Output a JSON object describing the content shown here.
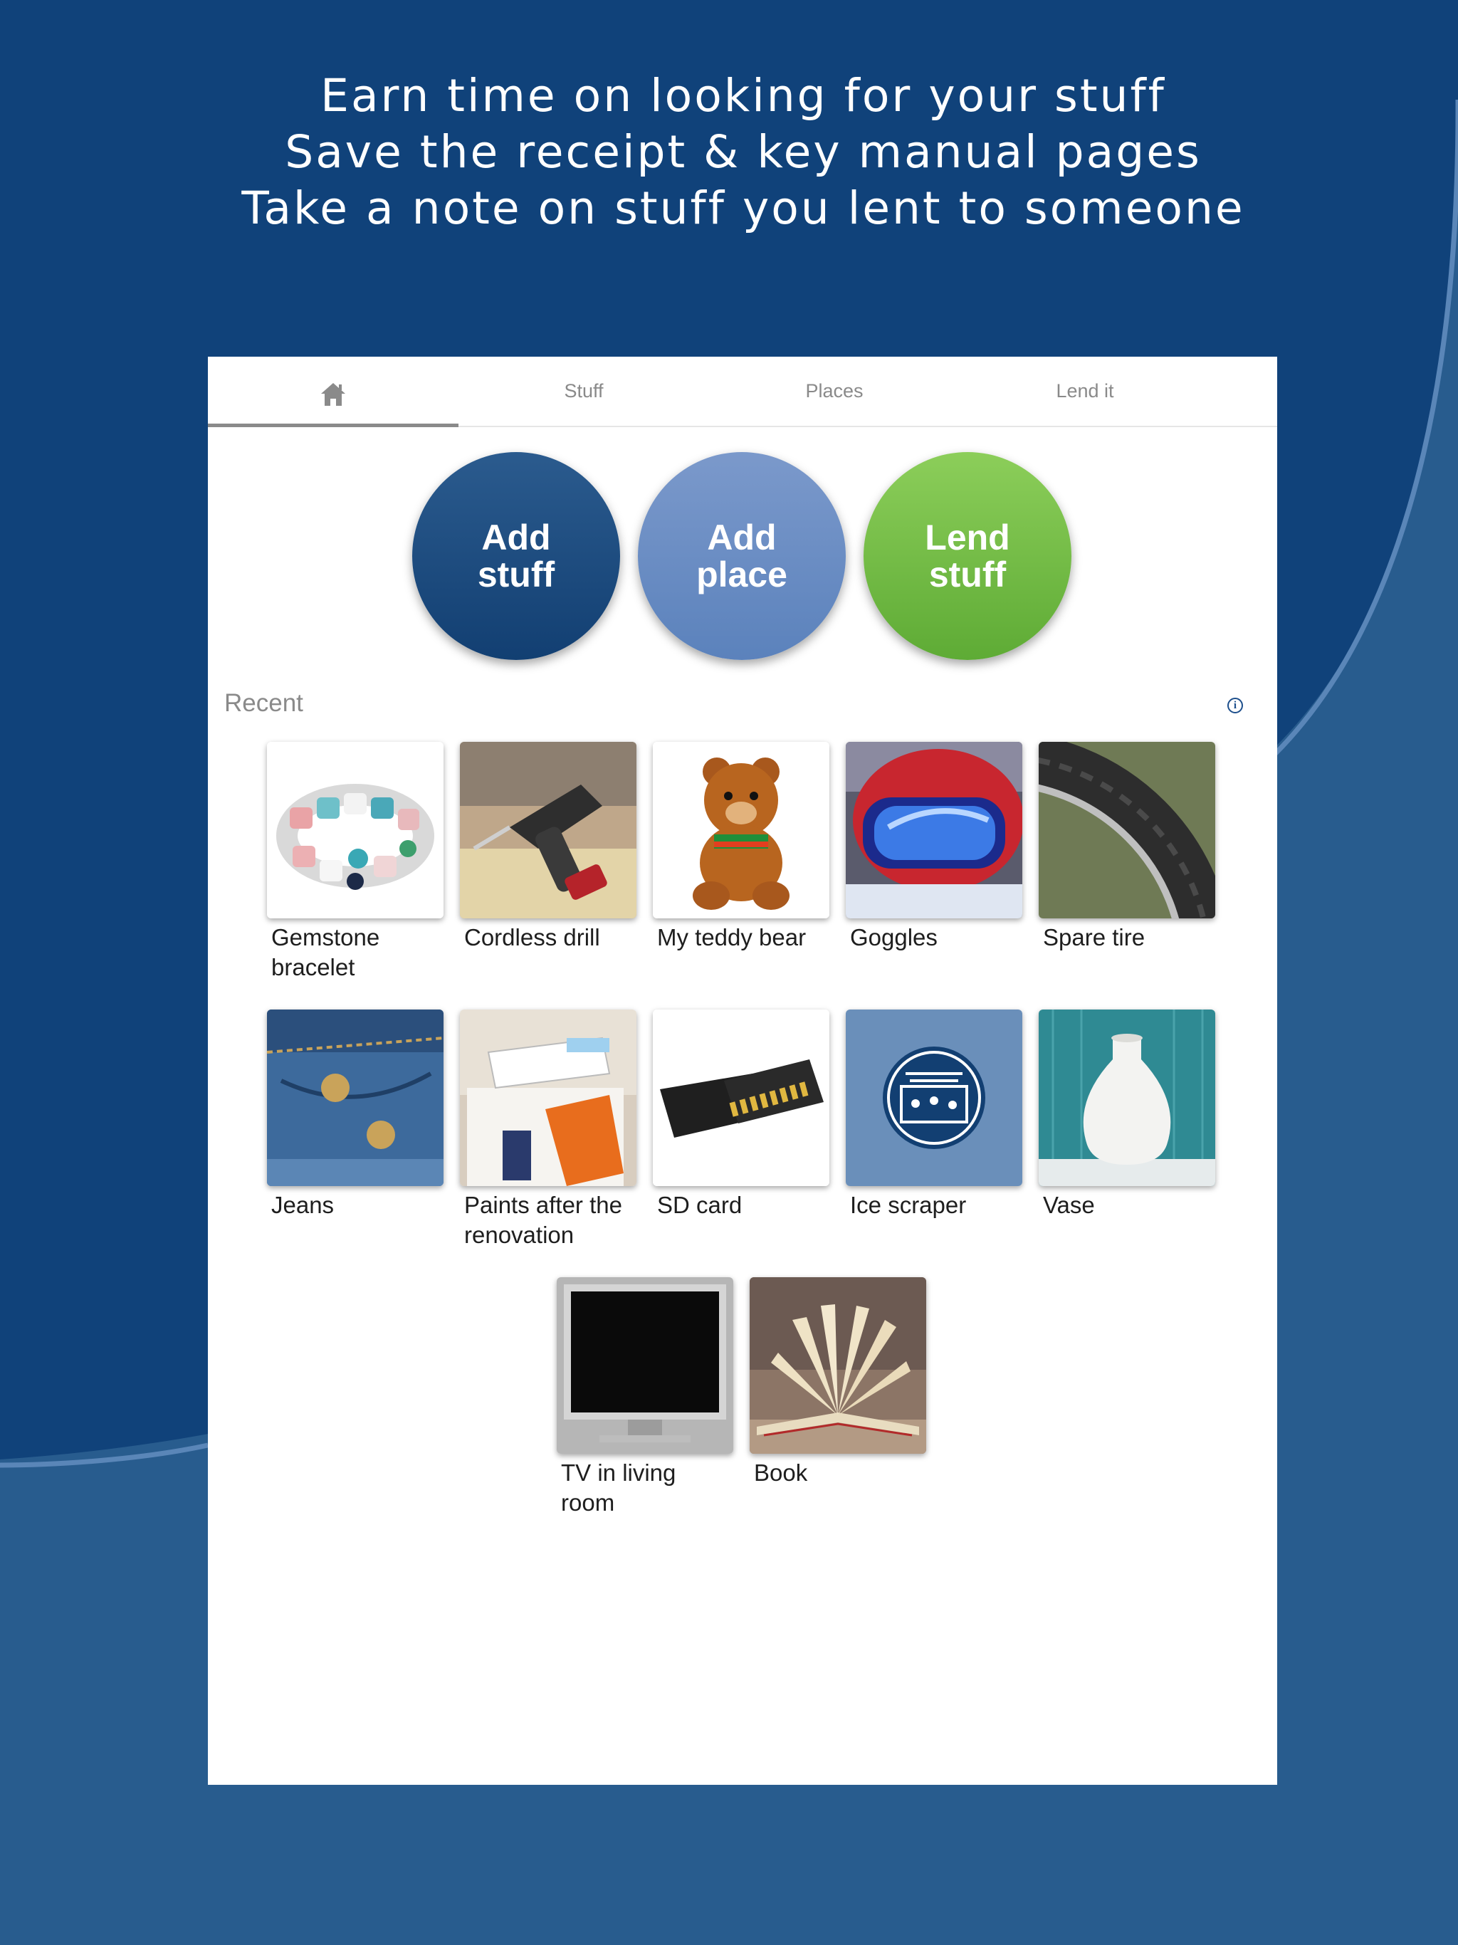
{
  "headline": {
    "line1": "Earn time on looking for your stuff",
    "line2": "Save the receipt & key manual pages",
    "line3": "Take a note on stuff you lent to someone"
  },
  "tabs": [
    {
      "label": "",
      "icon": "home-icon",
      "active": true
    },
    {
      "label": "Stuff",
      "active": false
    },
    {
      "label": "Places",
      "active": false
    },
    {
      "label": "Lend it",
      "active": false
    }
  ],
  "actions": {
    "add_stuff": "Add\nstuff",
    "add_place": "Add\nplace",
    "lend_stuff": "Lend\nstuff"
  },
  "recent": {
    "title": "Recent",
    "info_icon": "info-icon",
    "items": [
      {
        "label": "Gemstone bracelet"
      },
      {
        "label": "Cordless drill"
      },
      {
        "label": "My teddy bear"
      },
      {
        "label": "Goggles"
      },
      {
        "label": "Spare tire"
      },
      {
        "label": "Jeans"
      },
      {
        "label": "Paints after the renovation"
      },
      {
        "label": "SD card"
      },
      {
        "label": "Ice scraper"
      },
      {
        "label": "Vase"
      },
      {
        "label": "TV in living room"
      },
      {
        "label": "Book"
      }
    ]
  },
  "colors": {
    "background": "#285c8e",
    "background_dark": "#10427a",
    "add_stuff": "#1c4a7e",
    "add_place": "#6c8fc4",
    "lend_stuff": "#74bf48"
  }
}
